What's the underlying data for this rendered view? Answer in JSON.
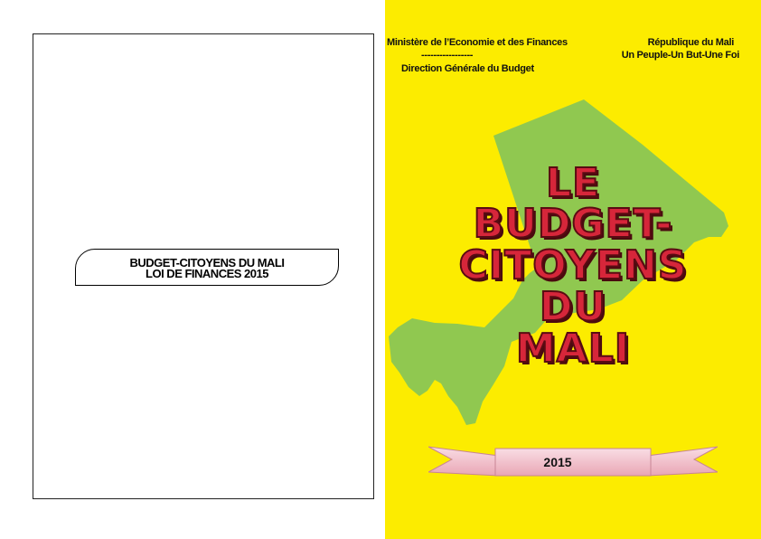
{
  "back_cover": {
    "title_line1": "BUDGET-CITOYENS DU MALI",
    "title_line2": "LOI DE FINANCES 2015"
  },
  "front_cover": {
    "ministry": "Ministère de l’Economie et des Finances",
    "separator": "-----------------",
    "directorate": "Direction Générale du Budget",
    "republic": "République du Mali",
    "motto": "Un Peuple-Un But-Une Foi",
    "title_lines": [
      "LE",
      "BUDGET-",
      "CITOYENS",
      "DU",
      "MALI"
    ],
    "year": "2015",
    "colors": {
      "background": "#fcec00",
      "map": "#90c850",
      "title": "#d6263a",
      "ribbon": "#f4c6d0"
    }
  }
}
